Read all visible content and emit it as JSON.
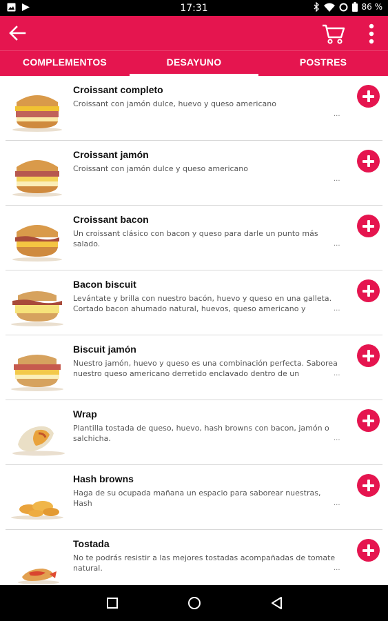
{
  "status_bar": {
    "time": "17:31",
    "battery": "86 %",
    "icons": [
      "image-icon",
      "play-store-icon",
      "bluetooth-icon",
      "wifi-icon",
      "sync-icon",
      "battery-icon"
    ]
  },
  "app_bar": {
    "icons": [
      "back-arrow-icon",
      "cart-icon",
      "more-vert-icon"
    ],
    "accent_color": "#e5154f"
  },
  "tabs": [
    {
      "label": "COMPLEMENTOS",
      "selected": false
    },
    {
      "label": "DESAYUNO",
      "selected": true
    },
    {
      "label": "POSTRES",
      "selected": false
    }
  ],
  "menu": {
    "items": [
      {
        "name": "Croissant completo",
        "description": "Croissant con jamón dulce, huevo y queso americano",
        "more": "...",
        "image": "croissant-full"
      },
      {
        "name": "Croissant jamón",
        "description": "Croissant con jamón dulce y queso americano",
        "more": "...",
        "image": "croissant-ham"
      },
      {
        "name": "Croissant bacon",
        "description": "Un croissant clásico con bacon y queso para darle un punto más salado.",
        "more": "...",
        "image": "croissant-bacon"
      },
      {
        "name": "Bacon biscuit",
        "description": "Levántate y brilla con nuestro bacón, huevo y queso en una galleta.\nCortado bacon ahumado natural, huevos, queso americano y cremosa...",
        "more": "...",
        "image": "biscuit-bacon"
      },
      {
        "name": "Biscuit jamón",
        "description": "Nuestro jamón, huevo y queso es una combinación perfecta. Saborea\nnuestro queso americano derretido enclavado dentro de un panecillo...",
        "more": "...",
        "image": "biscuit-ham"
      },
      {
        "name": "Wrap",
        "description": "Plantilla tostada de queso, huevo, hash browns con bacon, jamón o\nsalchicha.",
        "more": "...",
        "image": "wrap"
      },
      {
        "name": "Hash browns",
        "description": "Haga de su ocupada mañana un espacio para saborear nuestras, Hash\nBrowns de oro.",
        "more": "...",
        "image": "hash-browns"
      },
      {
        "name": "Tostada",
        "description": "No te podrás resistir a las mejores tostadas acompañadas de tomate\nnatural.",
        "more": "...",
        "image": "toast"
      }
    ]
  },
  "nav_bar": {
    "icons": [
      "recents-square-icon",
      "home-circle-icon",
      "back-triangle-icon"
    ]
  }
}
